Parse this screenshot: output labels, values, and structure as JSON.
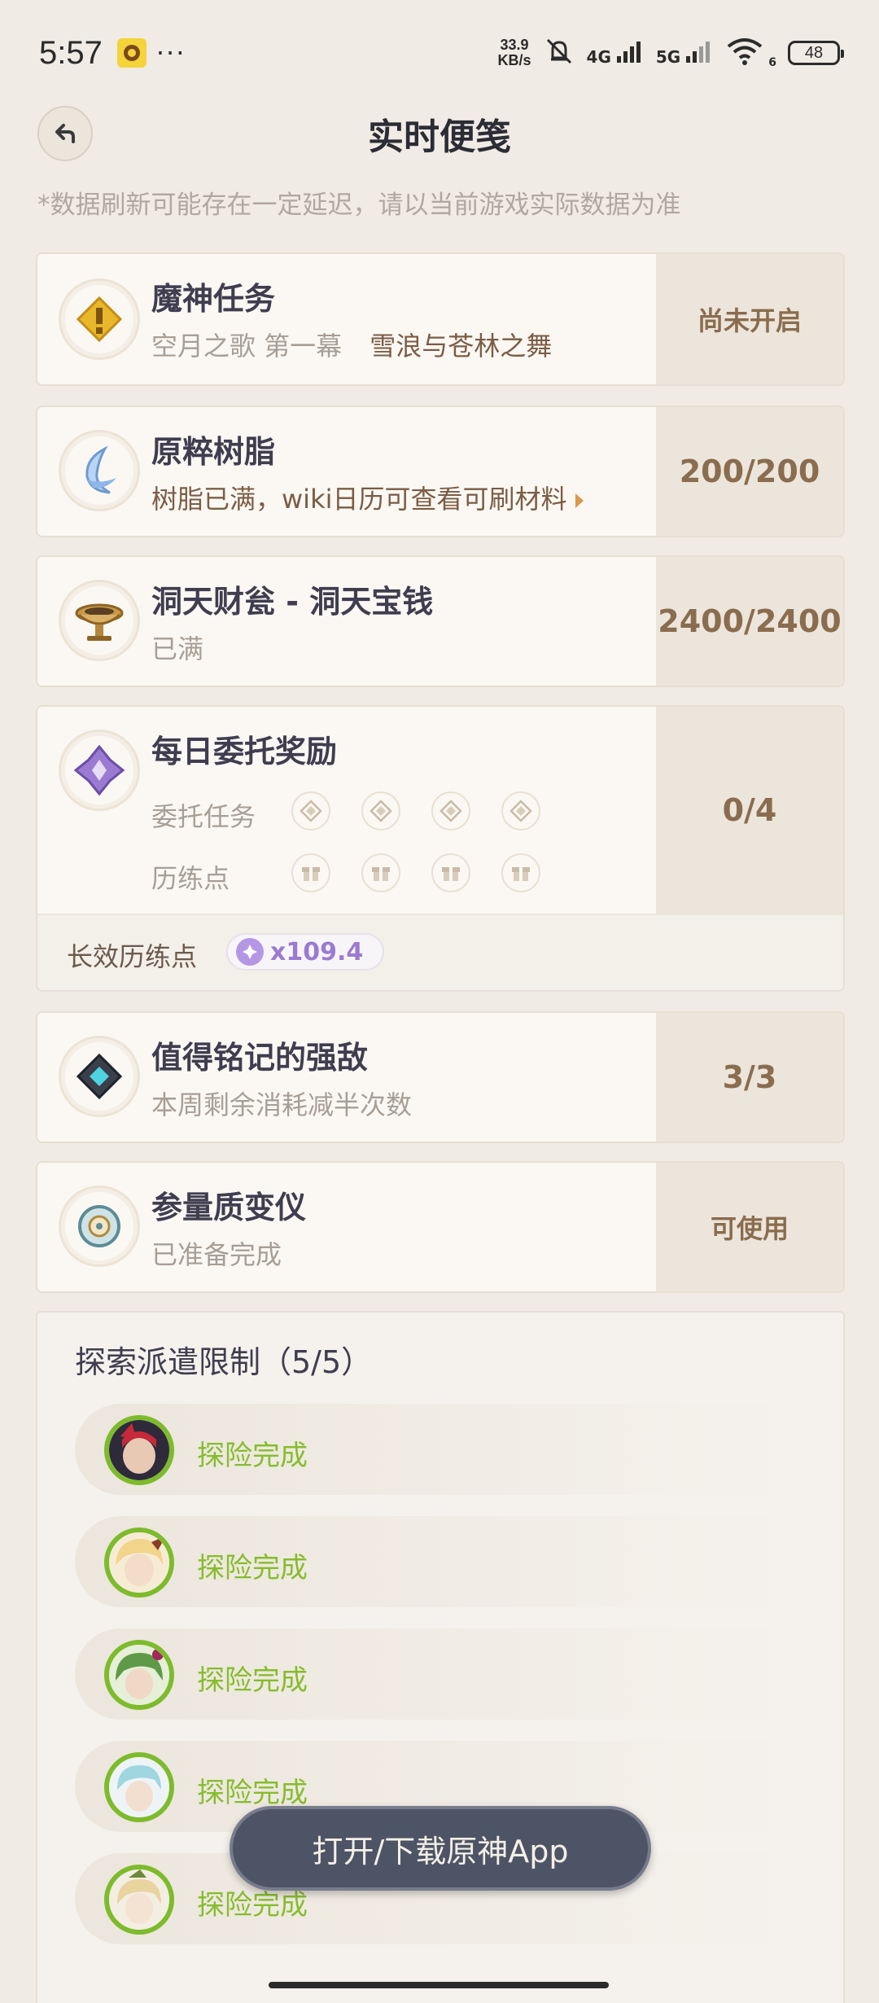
{
  "status_bar": {
    "time": "5:57",
    "dots": "···",
    "net_speed_value": "33.9",
    "net_speed_unit": "KB/s",
    "sig1": "4G",
    "sig2": "5G",
    "wifi_sub": "6",
    "battery": "48"
  },
  "header": {
    "title": "实时便笺"
  },
  "notice": "*数据刷新可能存在一定延迟，请以当前游戏实际数据为准",
  "archon": {
    "title": "魔神任务",
    "sub1": "空月之歌 第一幕",
    "sub2": "雪浪与苍林之舞",
    "status": "尚未开启"
  },
  "resin": {
    "title": "原粹树脂",
    "sub": "树脂已满，wiki日历可查看可刷材料",
    "value": "200/200"
  },
  "realm": {
    "title": "洞天财瓮 - 洞天宝钱",
    "sub": "已满",
    "value": "2400/2400"
  },
  "daily": {
    "title": "每日委托奖励",
    "row1_label": "委托任务",
    "row2_label": "历练点",
    "value": "0/4",
    "footer_label": "长效历练点",
    "footer_value": "x109.4"
  },
  "boss": {
    "title": "值得铭记的强敌",
    "sub": "本周剩余消耗减半次数",
    "value": "3/3"
  },
  "transformer": {
    "title": "参量质变仪",
    "sub": "已准备完成",
    "value": "可使用"
  },
  "expedition": {
    "title": "探索派遣限制（5/5）",
    "items": [
      {
        "status": "探险完成"
      },
      {
        "status": "探险完成"
      },
      {
        "status": "探险完成"
      },
      {
        "status": "探险完成"
      },
      {
        "status": "探险完成"
      }
    ]
  },
  "open_app_label": "打开/下载原神App",
  "colors": {
    "background": "#f0ebe4",
    "accent_brown": "#8a6c4e",
    "complete_green": "#86bd2c",
    "button_dark": "#4d5466"
  }
}
